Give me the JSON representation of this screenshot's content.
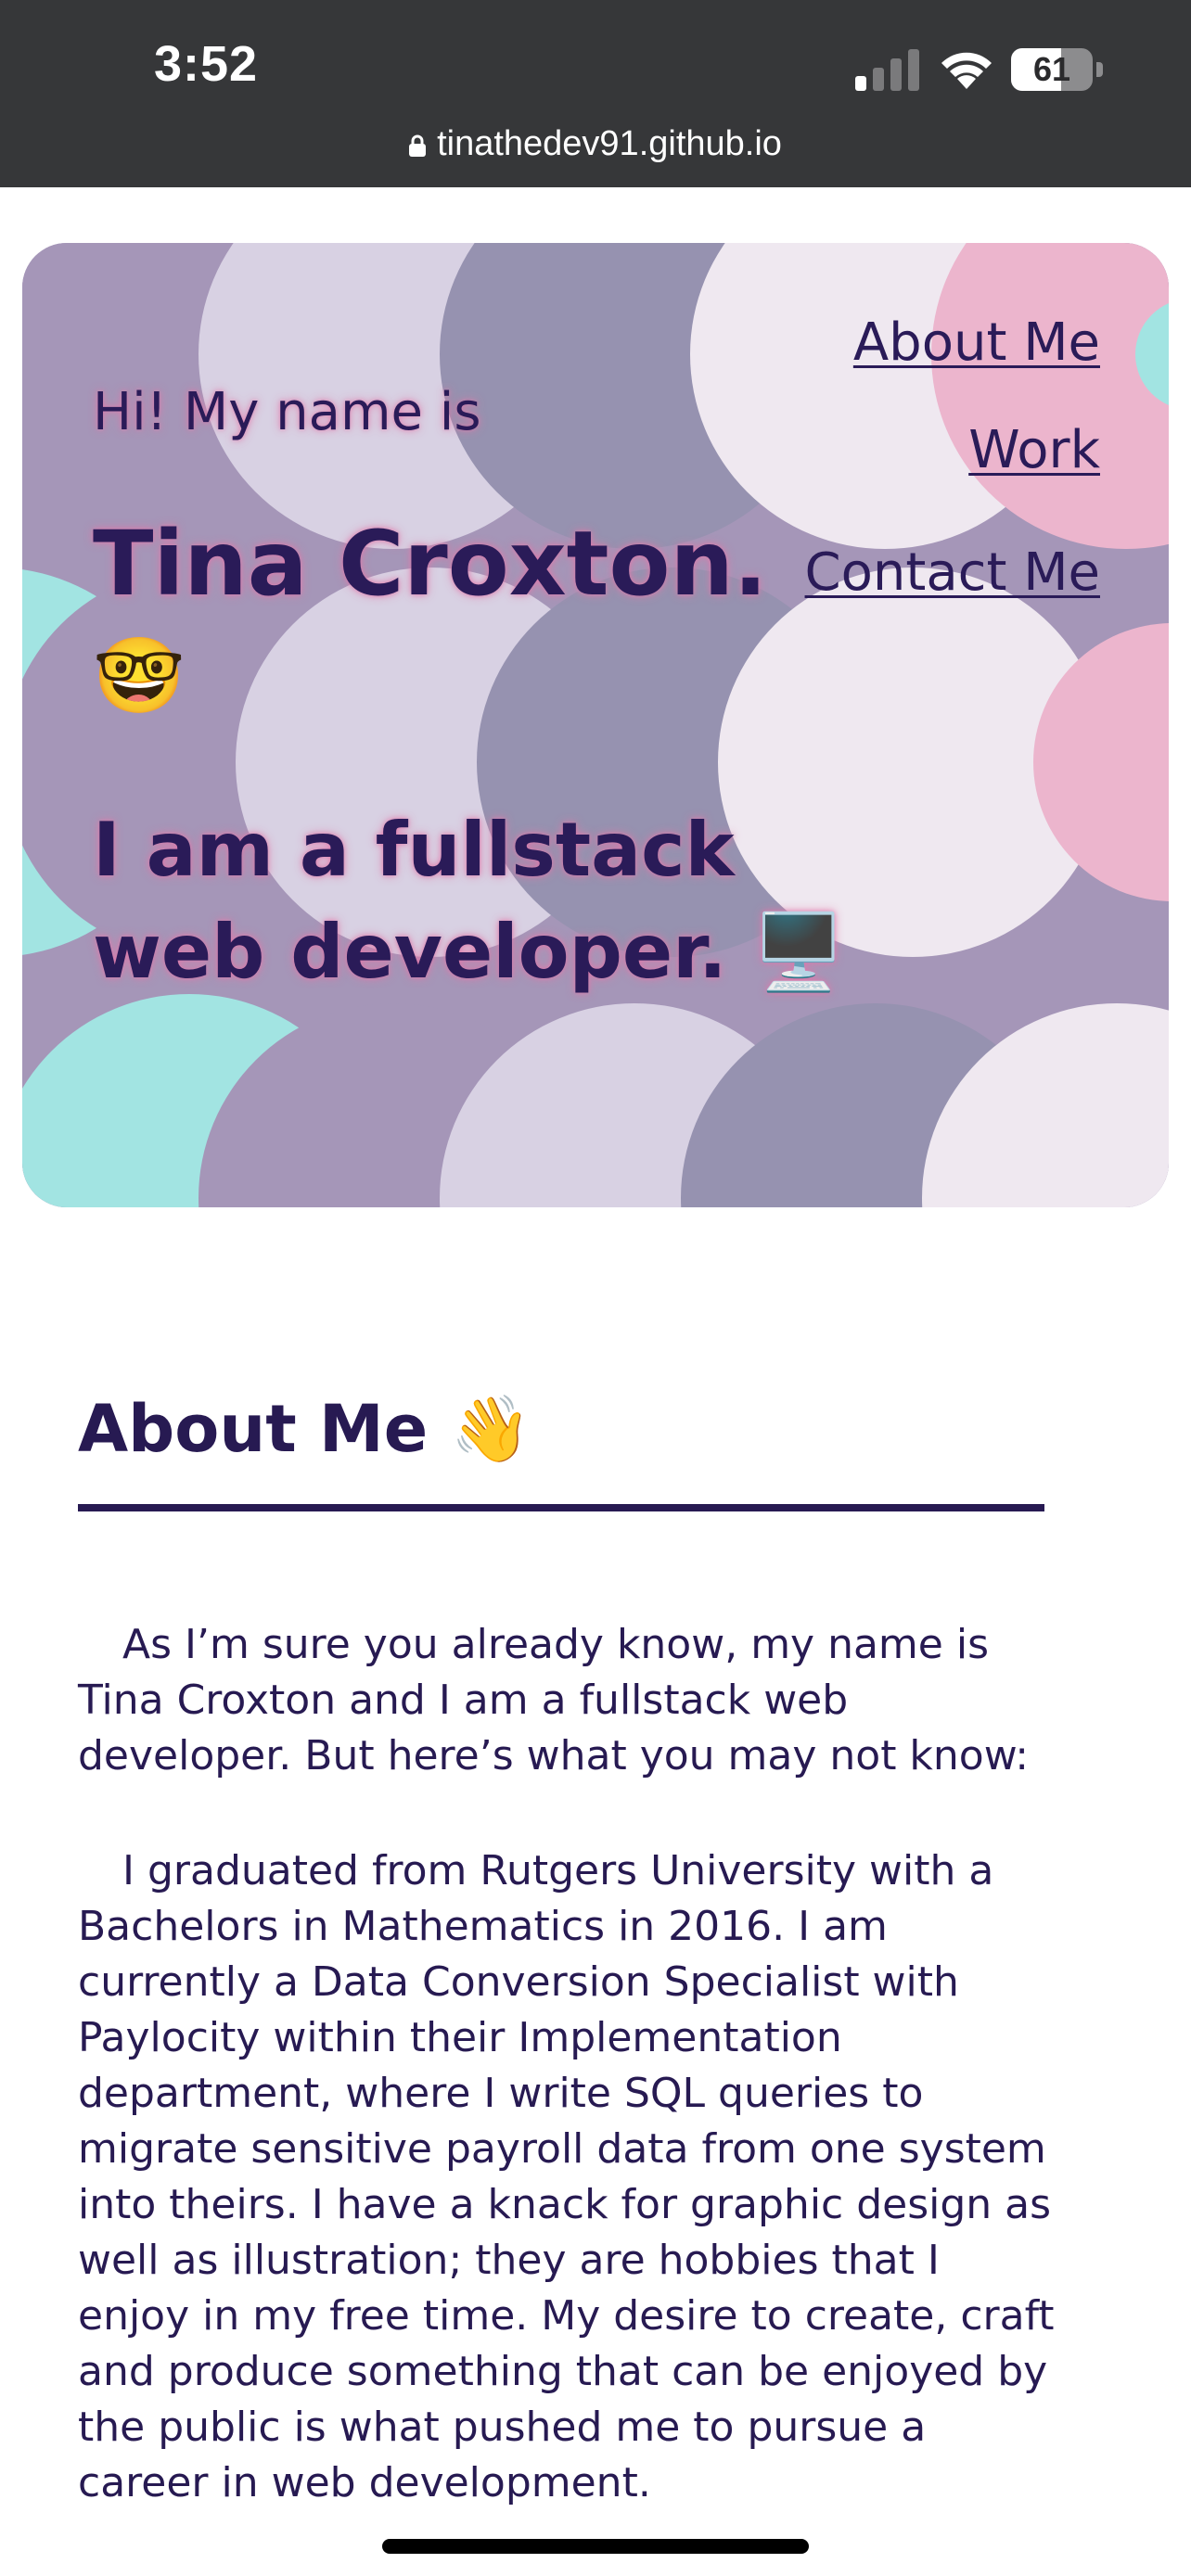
{
  "status_bar": {
    "time": "3:52",
    "battery_level": "61",
    "battery_fraction": 0.61,
    "icons": [
      "cellular-signal-icon",
      "wifi-icon",
      "battery-icon"
    ]
  },
  "browser": {
    "url": "tinathedev91.github.io",
    "icon": "lock-icon"
  },
  "hero": {
    "greeting": "Hi! My name is",
    "name": "Tina Croxton.",
    "name_emoji": "🤓",
    "tagline": "I am a fullstack web developer. 🖥️",
    "colors": {
      "text": "#2a1b58",
      "glow": "#e278aa",
      "mauve": "#a596b8",
      "lavender": "#d8d1e3",
      "slate": "#9692b0",
      "pale": "#efe8f0",
      "pink": "#ecb5cd",
      "aqua": "#a2e4e2"
    }
  },
  "nav": {
    "items": [
      {
        "label": "About Me"
      },
      {
        "label": "Work"
      },
      {
        "label": "Contact Me"
      }
    ]
  },
  "about": {
    "title": "About Me 👋",
    "paragraphs": [
      "As I’m sure you already know, my name is Tina Croxton and I am a fullstack web developer. But here’s what you may not know:",
      "I graduated from Rutgers University with a Bachelors in Mathematics in 2016. I am currently a Data Conversion Specialist with Paylocity within their Implementation department, where I write SQL queries to migrate sensitive payroll data from one system into theirs. I have a knack for graphic design as well as illustration; they are hobbies that I enjoy in my free time. My desire to create, craft and produce something that can be enjoyed by the public is what pushed me to pursue a career in web development."
    ],
    "color": "#271a52"
  }
}
